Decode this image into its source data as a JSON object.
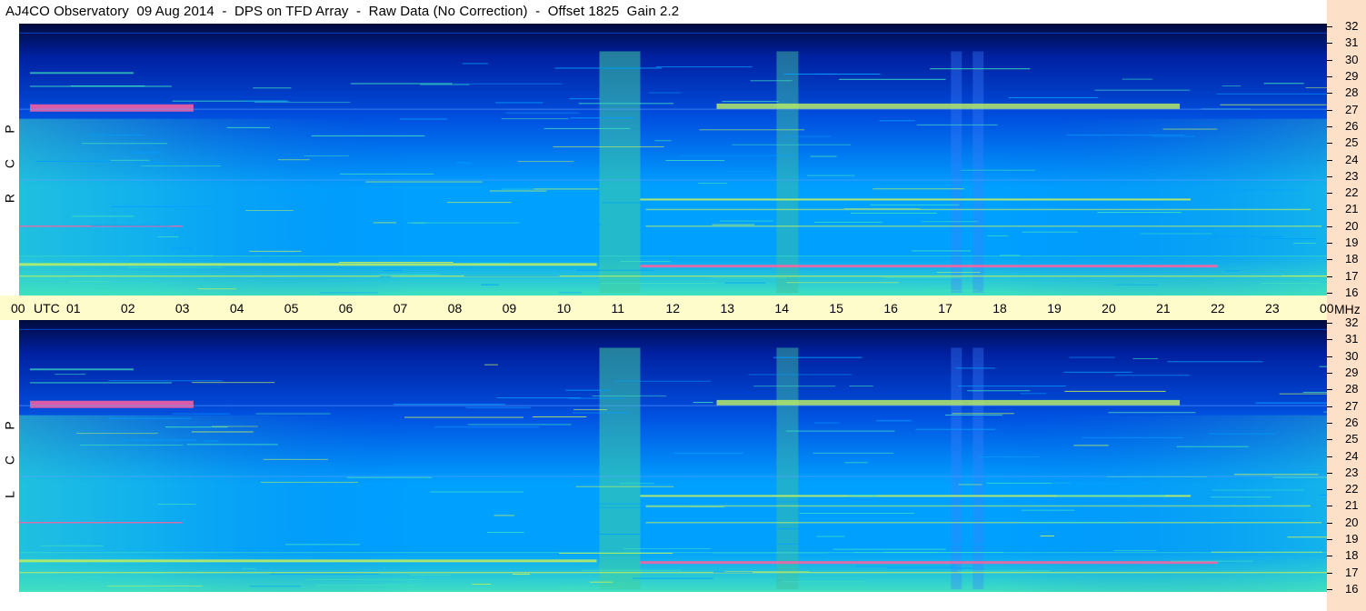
{
  "title": "AJ4CO Observatory  09 Aug 2014  -  DPS on TFD Array  -  Raw Data (No Correction)  -  Offset 1825  Gain 2.2",
  "time_axis": {
    "start_label": "00",
    "utc_label": "UTC",
    "ticks": [
      "01",
      "02",
      "03",
      "04",
      "05",
      "06",
      "07",
      "08",
      "09",
      "10",
      "11",
      "12",
      "13",
      "14",
      "15",
      "16",
      "17",
      "18",
      "19",
      "20",
      "21",
      "22",
      "23",
      "00"
    ],
    "unit": "MHz"
  },
  "panels": [
    {
      "id": "rcp",
      "letters": [
        "R",
        "C",
        "P"
      ]
    },
    {
      "id": "lcp",
      "letters": [
        "L",
        "C",
        "P"
      ]
    }
  ],
  "freq_ticks": [
    "32",
    "31",
    "30",
    "29",
    "28",
    "27",
    "26",
    "25",
    "24",
    "23",
    "22",
    "21",
    "20",
    "19",
    "18",
    "17",
    "16"
  ],
  "chart_data": {
    "type": "heatmap",
    "title": "AJ4CO Observatory  09 Aug 2014  -  DPS on TFD Array  -  Raw Data (No Correction)  -  Offset 1825  Gain 2.2",
    "x_label": "UTC",
    "x_range_hours": [
      0,
      24
    ],
    "y_unit": "MHz",
    "y_range": [
      16,
      32
    ],
    "series": [
      {
        "name": "RCP",
        "bright_bands_mhz": [
          27,
          21.6,
          20,
          17.7,
          17
        ]
      },
      {
        "name": "LCP",
        "bright_bands_mhz": [
          27,
          21.6,
          20,
          17.7,
          17
        ]
      }
    ],
    "colormap": [
      "#000a3c",
      "#0020a0",
      "#0050e0",
      "#00a0ff",
      "#40e0c0",
      "#c0f060",
      "#ff60a0",
      "#ffffff"
    ]
  }
}
